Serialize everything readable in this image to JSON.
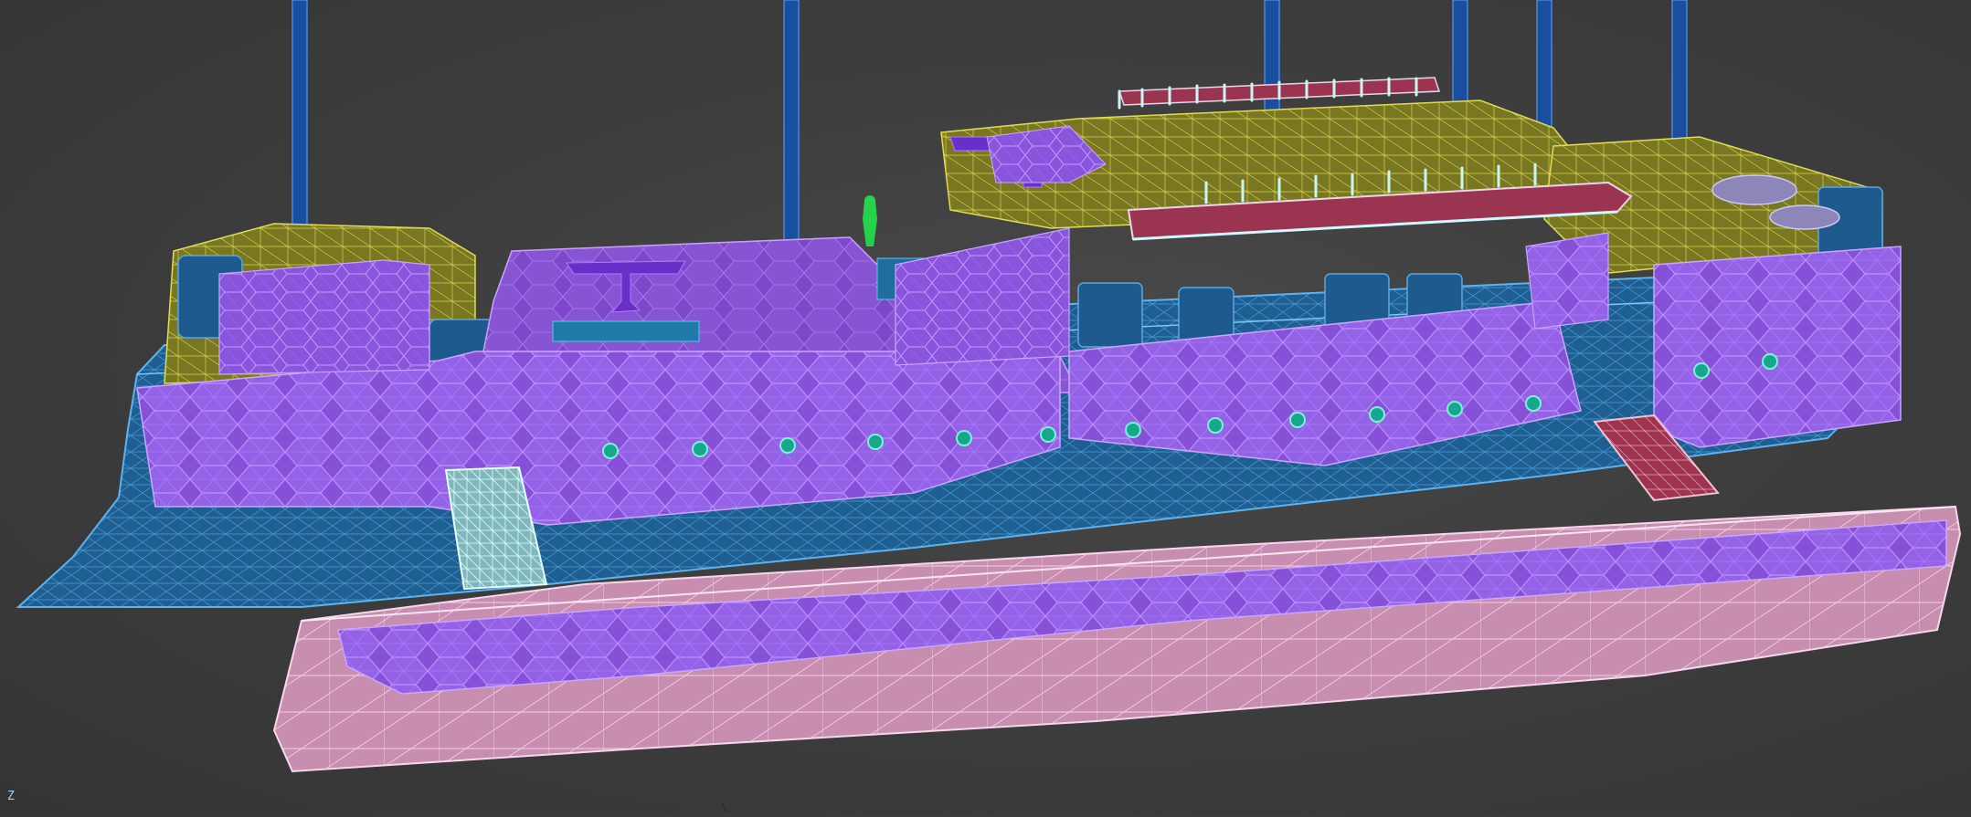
{
  "viewport": {
    "axis_label": "Z"
  },
  "colors": {
    "background": "#3e3e3e",
    "hull_blue": "#1d5f92",
    "hull_wire": "#4fa4e0",
    "hex_purple": "#8a52dc",
    "hex_wire": "#b98cff",
    "pontoon_pink": "#c98fb0",
    "pontoon_wire": "#f1c6e4",
    "deck_olive": "#7d7a24",
    "deck_wire": "#d5d24a",
    "mast_blue": "#1a4fa0",
    "rail_cyan": "#bff3f0",
    "porthole_teal": "#1fb59a",
    "figure_green": "#26d24a",
    "ramp_red": "#a4334f"
  }
}
